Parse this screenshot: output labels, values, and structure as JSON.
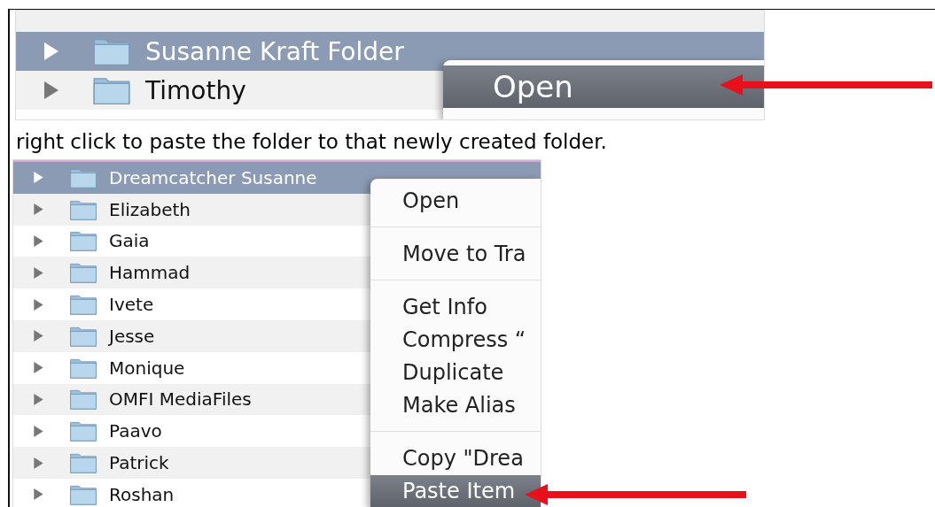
{
  "screenshots": [
    {
      "kind": "large",
      "rows": [
        {
          "name": "Susanne Kraft Folder",
          "selected": true
        },
        {
          "name": "Timothy",
          "selected": false
        }
      ],
      "menu": [
        {
          "kind": "item",
          "label": "Open",
          "selected": true
        }
      ]
    },
    {
      "kind": "small",
      "rows": [
        {
          "name": "Dreamcatcher Susanne",
          "selected": true
        },
        {
          "name": "Elizabeth",
          "selected": false
        },
        {
          "name": "Gaia",
          "selected": false
        },
        {
          "name": "Hammad",
          "selected": false
        },
        {
          "name": "Ivete",
          "selected": false
        },
        {
          "name": "Jesse",
          "selected": false
        },
        {
          "name": "Monique",
          "selected": false
        },
        {
          "name": "OMFI MediaFiles",
          "selected": false
        },
        {
          "name": "Paavo",
          "selected": false
        },
        {
          "name": "Patrick",
          "selected": false
        },
        {
          "name": "Roshan",
          "selected": false
        }
      ],
      "menu": [
        {
          "kind": "item",
          "label": "Open",
          "selected": false
        },
        {
          "kind": "separator"
        },
        {
          "kind": "item",
          "label": "Move to Tra",
          "selected": false
        },
        {
          "kind": "separator"
        },
        {
          "kind": "item",
          "label": "Get Info",
          "selected": false
        },
        {
          "kind": "item",
          "label": "Compress “",
          "selected": false
        },
        {
          "kind": "item",
          "label": "Duplicate",
          "selected": false
        },
        {
          "kind": "item",
          "label": "Make Alias",
          "selected": false
        },
        {
          "kind": "separator"
        },
        {
          "kind": "item",
          "label": "Copy \"Drea",
          "selected": false
        },
        {
          "kind": "item",
          "label": "Paste Item",
          "selected": true
        }
      ]
    }
  ],
  "caption": "right click to paste the folder to that newly created folder."
}
